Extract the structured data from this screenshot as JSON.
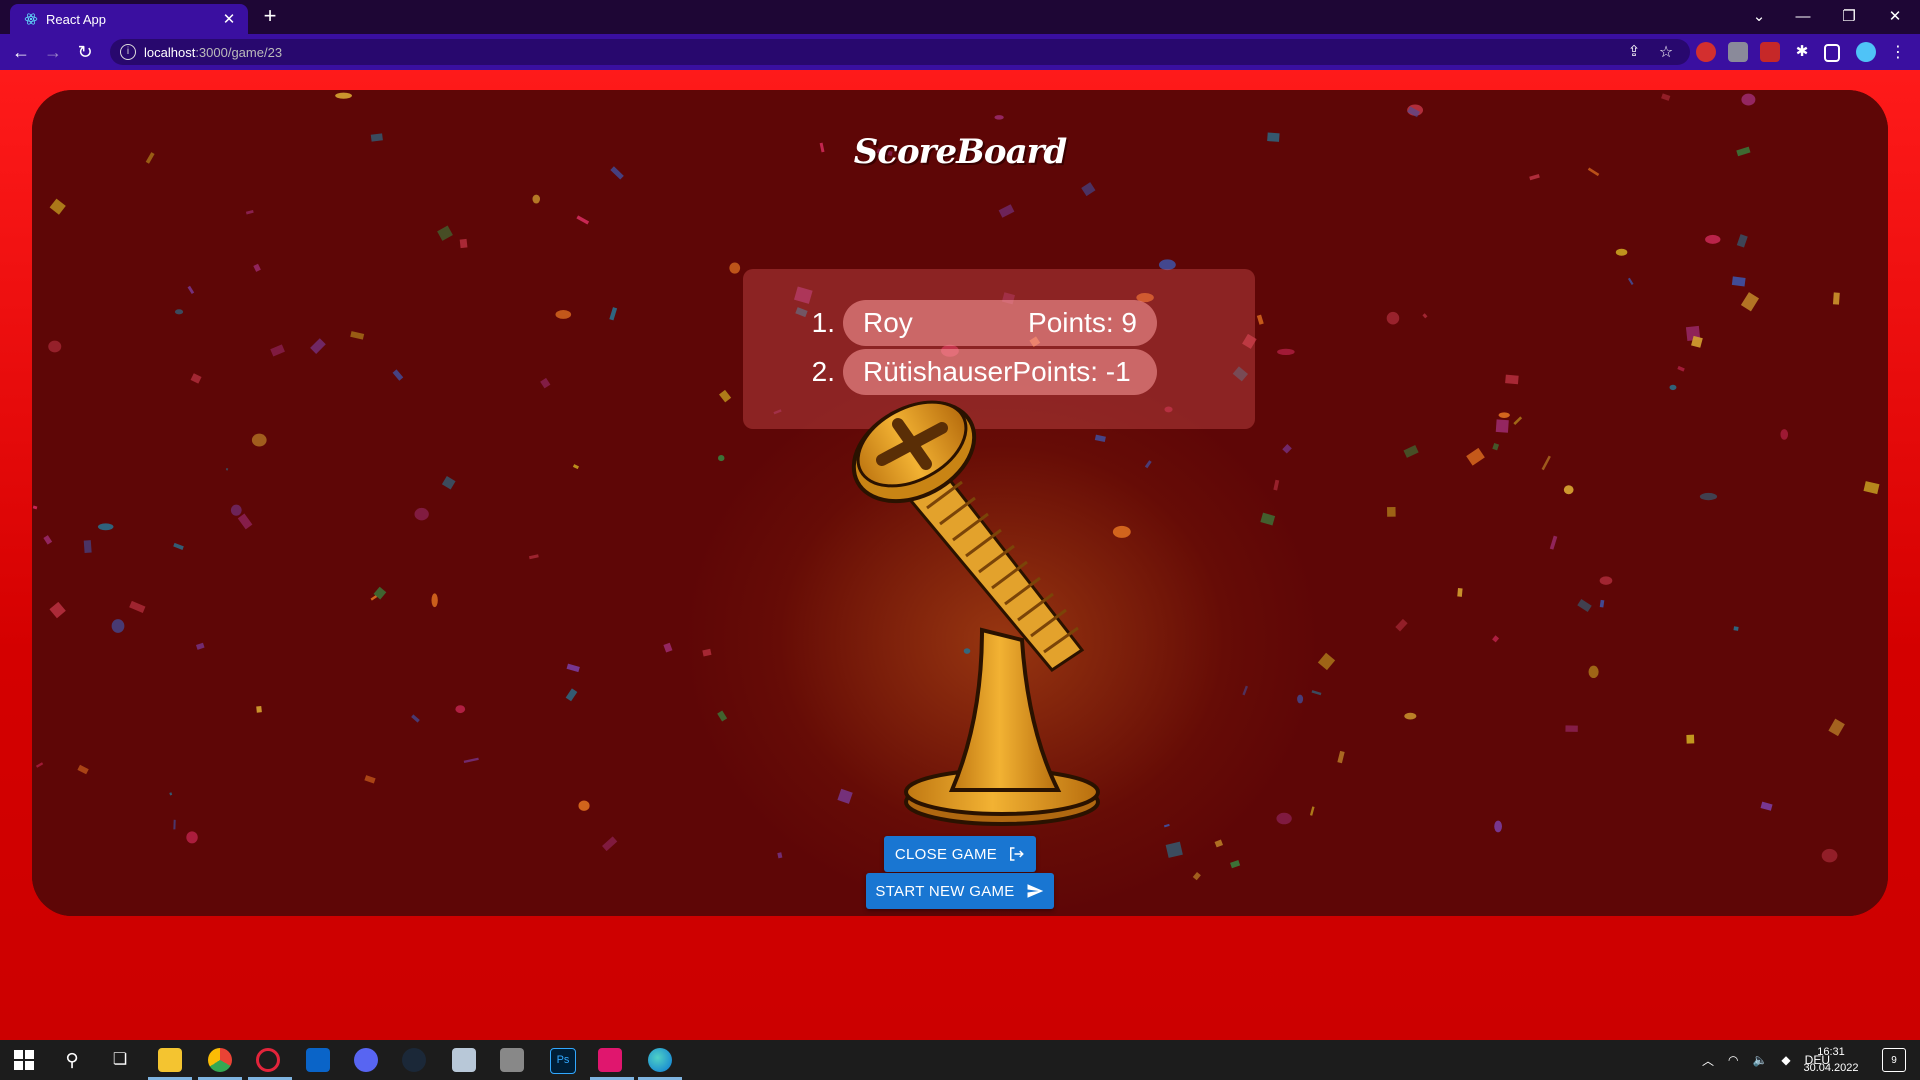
{
  "browser": {
    "tab_title": "React App",
    "new_tab": "+",
    "url_host": "localhost",
    "url_path": ":3000/game/23"
  },
  "page": {
    "heading": "ScoreBoard",
    "scores": [
      {
        "rank": "1.",
        "name": "Roy",
        "points": "Points: 9"
      },
      {
        "rank": "2.",
        "name": "Rütishauser",
        "points": "Points: -1"
      }
    ],
    "close_game_label": "CLOSE GAME",
    "start_new_game_label": "START NEW GAME"
  },
  "taskbar": {
    "language": "DEU",
    "time": "16:31",
    "date": "30.04.2022",
    "notifications": "9"
  },
  "colors": {
    "page_background": "#e30000",
    "card_background": "#5e0606",
    "button": "#1976d2",
    "tab_active": "#3a0fa0"
  }
}
